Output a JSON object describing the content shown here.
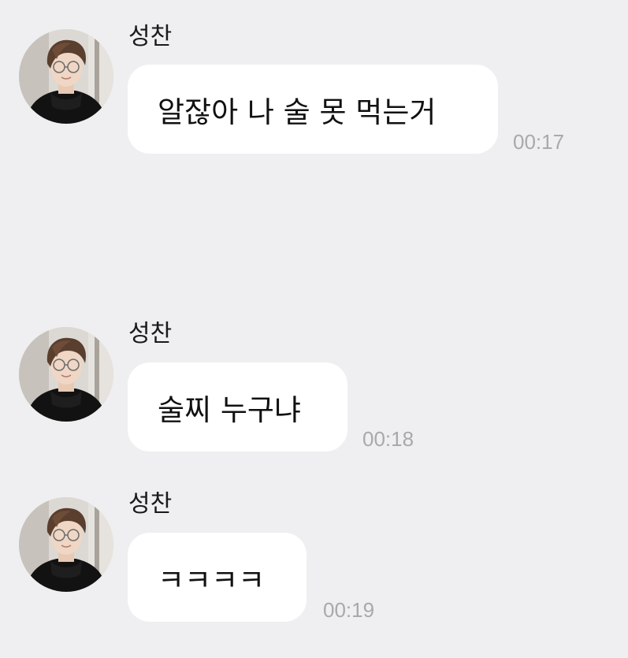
{
  "messages": [
    {
      "sender": "성찬",
      "text": "알잖아 나 술 못 먹는거",
      "time": "00:17"
    },
    {
      "sender": "성찬",
      "text": "술찌 누구냐",
      "time": "00:18"
    },
    {
      "sender": "성찬",
      "text": "ㅋㅋㅋㅋ",
      "time": "00:19"
    }
  ],
  "colors": {
    "background": "#efeff1",
    "bubble": "#ffffff",
    "time_text": "#a9a9ad"
  },
  "icons": {
    "avatar": "profile-photo"
  }
}
